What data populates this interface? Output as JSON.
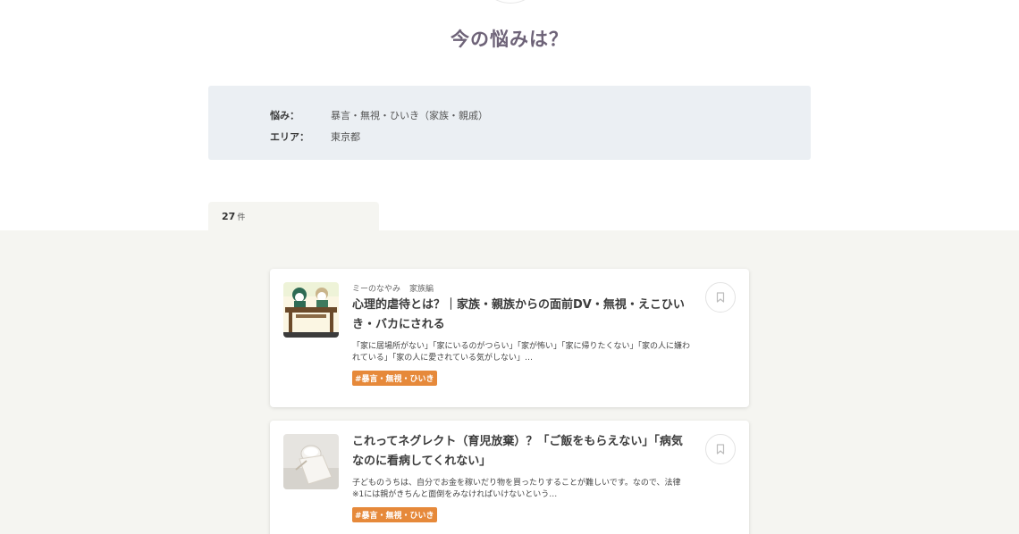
{
  "header": {
    "title": "今の悩みは？"
  },
  "filters": {
    "worry_label": "悩み：",
    "worry_value": "暴言・無視・ひいき（家族・親戚）",
    "area_label": "エリア：",
    "area_value": "東京都"
  },
  "results": {
    "count": "27",
    "unit": "件"
  },
  "cards": [
    {
      "meta_source": "ミーのなやみ",
      "meta_category": "家族編",
      "title": "心理的虐待とは？｜家族・親族からの面前DV・無視・えこひいき・バカにされる",
      "excerpt": "「家に居場所がない」「家にいるのがつらい」「家が怖い」「家に帰りたくない」「家の人に嫌われている」「家の人に愛されている気がしない」…",
      "tag": "#暴言・無視・ひいき",
      "thumb_icon": "illustration-thumbnail",
      "bookmark_icon": "bookmark-icon"
    },
    {
      "title": "これってネグレクト（育児放棄）？「ご飯をもらえない」「病気なのに看病してくれない」",
      "excerpt": "子どものうちは、自分でお金を稼いだり物を買ったりすることが難しいです。なので、法律※1には親がきちんと面倒をみなければいけないという…",
      "tag": "#暴言・無視・ひいき",
      "thumb_icon": "photo-thumbnail",
      "bookmark_icon": "bookmark-icon"
    }
  ],
  "colors": {
    "title": "#6e6378",
    "filter_bg": "#ebeff3",
    "list_bg": "#f5f5f1",
    "tag_bg": "#e6893a"
  }
}
